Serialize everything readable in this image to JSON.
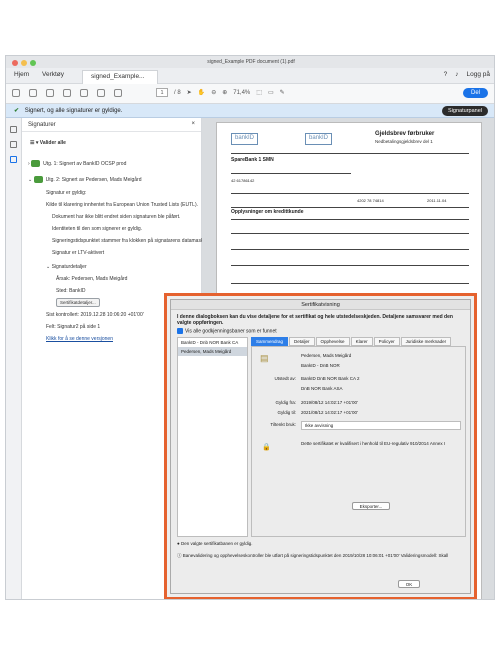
{
  "window": {
    "title": "signed_Example PDF document (1).pdf"
  },
  "tabs": {
    "home": "Hjem",
    "tools": "Verktøy",
    "doc": "signed_Example...",
    "login": "Logg på"
  },
  "toolbar": {
    "page_current": "1",
    "page_total": "/ 8",
    "zoom": "71,4%",
    "share": "Del"
  },
  "sigbar": {
    "message": "Signert, og alle signaturer er gyldige.",
    "panel_button": "Signaturpanel"
  },
  "signature_pane": {
    "title": "Signaturer",
    "validate_all": "Valider alle",
    "rev1": "Utg. 1: Signert av BankID OCSP prod",
    "rev2": "Utg. 2: Signert av Pedersen, Mads Meigård",
    "details": [
      "Signatur er gyldig:",
      "Kilde til klarering innhentet fra European Union Trusted Lists (EUTL).",
      "Dokument har ikke blitt endret siden signaturen ble påført.",
      "Identiteten til den som signerer er gyldig.",
      "Signeringstidspunktet stammer fra klokken på signatarens datamaskin.",
      "Signatur er LTV-aktivert"
    ],
    "sig_details": "Signaturdetaljer",
    "sig_reason": "Årsak: Pedersen, Mads Meigård",
    "sig_location": "Sted: BankID",
    "cert_button": "Sertifikatdetaljer...",
    "last_checked": "Sist kontrollert: 2019.12.28 10:06:20 +01'00'",
    "field": "Felt: Signatur2 på side 1",
    "link": "Klikk for å se denne versjonen"
  },
  "document": {
    "stamp1": "bankID",
    "stamp2": "bankID",
    "title": "Gjeldsbrev førbruker",
    "subtitle": "Nedbetalingsgjeldsbrev del 1",
    "borrower_section": "Opplysninger om kredittkunde",
    "bank": "SpareBank 1 SMN",
    "account": "42 61786142",
    "fee": "4202 78 74814",
    "date": "2011.11.04"
  },
  "modal": {
    "title": "Sertifikatvisning",
    "description": "I denne dialogboksen kan du vise detaljene for et sertifikat og hele utstedelseskjeden. Detaljene samsvarer med den valgte oppføringen.",
    "show_all": "Vis alle godkjenningsbaner som er funnet",
    "tree": [
      "BankID - Dnb NOR Bank CA",
      "Pedersen, Mads Meigård"
    ],
    "tabs": [
      "Sammendrag",
      "Detaljer",
      "Opphevelse",
      "Klarer",
      "Policyer",
      "Juridiske merknader"
    ],
    "fields": {
      "subject_name": "Pedersen, Mads Meigård",
      "subject_org": "BankID - DnB NOR",
      "issuer_label": "Utstedt av:",
      "issuer_1": "BankID DnB NOR Bank CA 2",
      "issuer_2": "DnB NOR Bank ASA",
      "from_label": "Gyldig fra:",
      "from": "2019/08/12 14:02:17 +01'00'",
      "to_label": "Gyldig til:",
      "to": "2021/08/12 14:02:17 +01'00'",
      "use_label": "Tiltenkt bruk:",
      "use": "Ikke avvisning",
      "qualified": "Dette sertifikatet er kvalifisert i henhold til EU-regulativ 910/2014 Annex I"
    },
    "export": "Eksporter...",
    "status": "Den valgte sertifikatbanen er gyldig.",
    "info": "Banevalidering og opphevelseskontroller ble utført på signeringstidspunktet den 2019/10/28 10:06:01 +01'00' Valideringsmodell: Skall",
    "ok": "OK"
  }
}
